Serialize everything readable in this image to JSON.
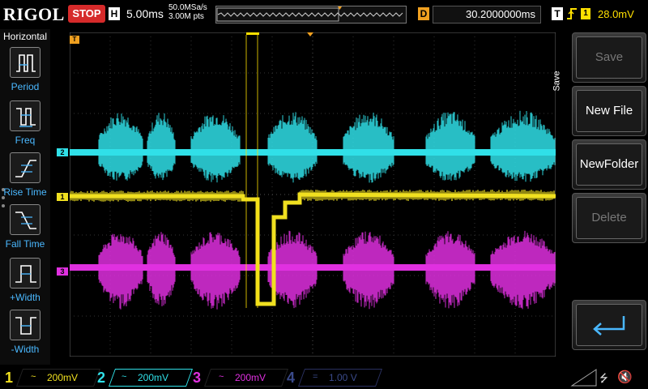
{
  "topbar": {
    "brand": "RIGOL",
    "run_state": "STOP",
    "horizontal_icon": "H",
    "timebase": "5.00ms",
    "sample_rate": "50.0MSa/s",
    "memory_depth": "3.00M pts",
    "delay_icon": "D",
    "delay_value": "30.2000000ms",
    "trigger_icon": "T",
    "trigger_edge_icon": "rising-edge-icon",
    "trigger_source": "1",
    "trigger_level": "28.0mV"
  },
  "leftbar": {
    "title": "Horizontal",
    "items": [
      {
        "label": "Period",
        "icon": "period-icon"
      },
      {
        "label": "Freq",
        "icon": "frequency-icon"
      },
      {
        "label": "Rise Time",
        "icon": "rise-time-icon"
      },
      {
        "label": "Fall Time",
        "icon": "fall-time-icon"
      },
      {
        "label": "+Width",
        "icon": "positive-width-icon"
      },
      {
        "label": "-Width",
        "icon": "negative-width-icon"
      }
    ]
  },
  "rightmenu": {
    "section": "Save",
    "items": [
      {
        "label": "Save",
        "enabled": false
      },
      {
        "label": "New File",
        "enabled": true
      },
      {
        "label": "NewFolder",
        "enabled": true
      },
      {
        "label": "Delete",
        "enabled": false
      }
    ],
    "return_icon": "return-arrow-icon"
  },
  "channels": [
    {
      "num": "1",
      "coupling": "~",
      "scale": "200mV",
      "color": "#f0e020"
    },
    {
      "num": "2",
      "coupling": "~",
      "scale": "200mV",
      "color": "#30e0e8"
    },
    {
      "num": "3",
      "coupling": "~",
      "scale": "200mV",
      "color": "#e030e0"
    },
    {
      "num": "4",
      "coupling": "=",
      "scale": "1.00 V",
      "color": "#3a4a8a"
    }
  ],
  "markers": {
    "trigger_marker": "T",
    "ch1_marker": "1",
    "ch2_marker": "2",
    "ch3_marker": "3",
    "right_trigger_marker": "T"
  },
  "status_icons": {
    "usb": "usb-icon",
    "sound": "speaker-muted-icon"
  }
}
